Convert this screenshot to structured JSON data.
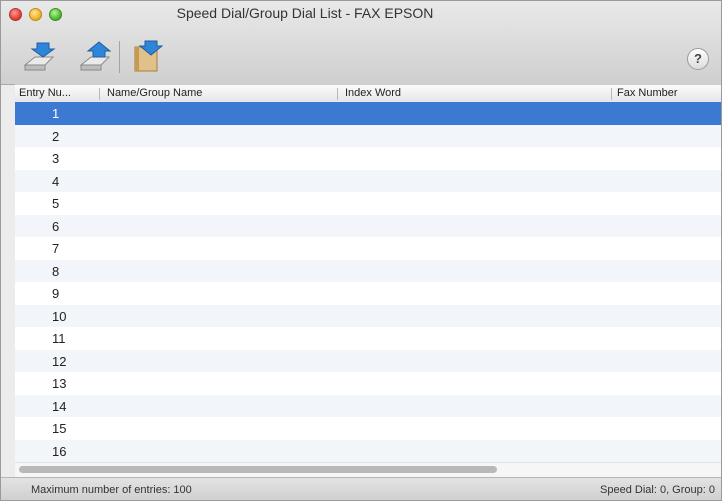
{
  "window": {
    "title": "Speed Dial/Group Dial List - FAX EPSON"
  },
  "toolbar": {
    "buttons": [
      {
        "name": "import-icon"
      },
      {
        "name": "export-icon"
      },
      {
        "name": "address-book-icon"
      }
    ],
    "help_label": "?"
  },
  "table": {
    "columns": [
      "Entry Nu...",
      "Name/Group Name",
      "Index Word",
      "Fax Number"
    ],
    "rows": [
      "1",
      "2",
      "3",
      "4",
      "5",
      "6",
      "7",
      "8",
      "9",
      "10",
      "11",
      "12",
      "13",
      "14",
      "15",
      "16"
    ],
    "selected_row": "1"
  },
  "status": {
    "max_entries": "Maximum number of entries: 100",
    "counts": "Speed Dial: 0, Group: 0"
  },
  "colors": {
    "selection": "#3b79d3",
    "stripe": "#f2f5fa"
  }
}
